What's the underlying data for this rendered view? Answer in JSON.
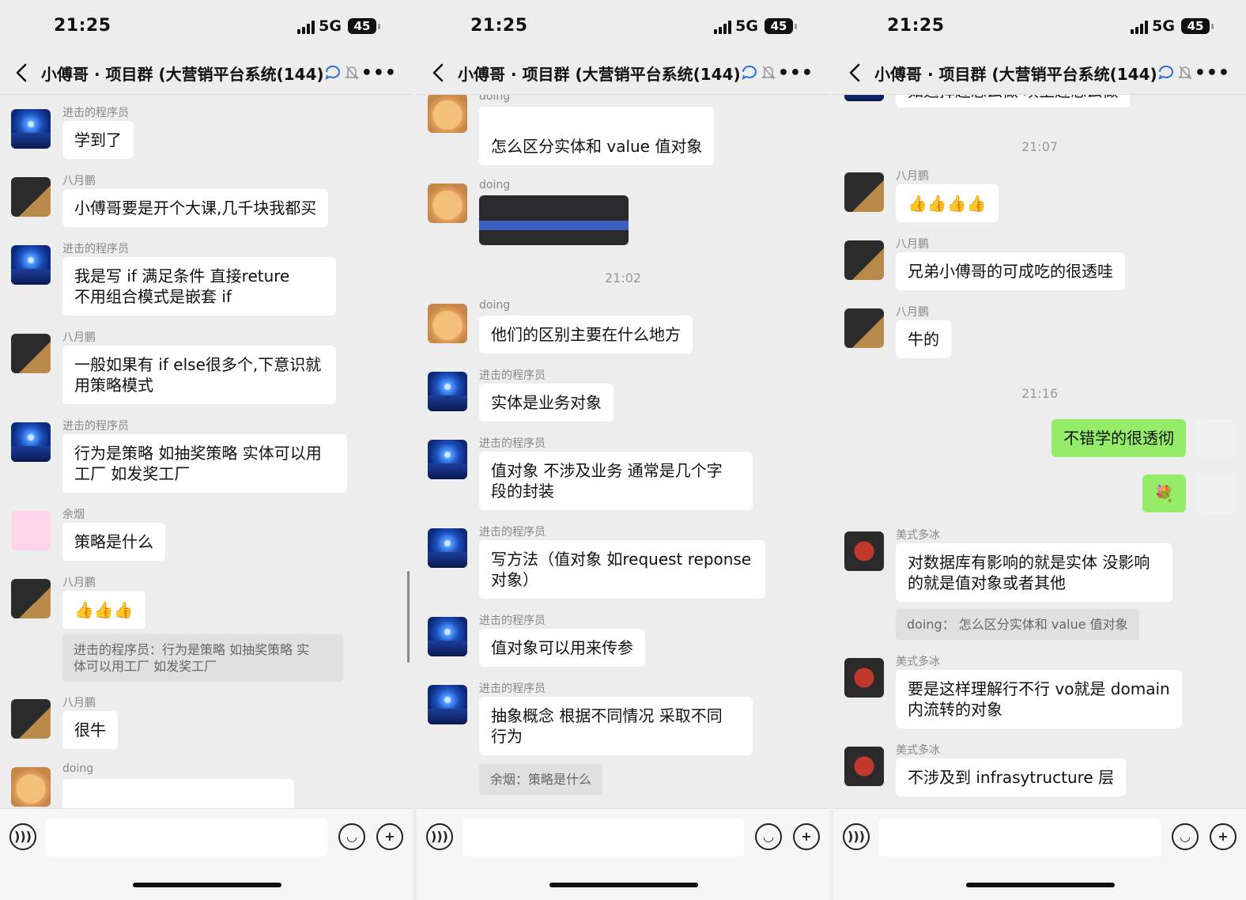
{
  "status": {
    "time": "21:25",
    "network": "5G",
    "battery": "45"
  },
  "navbar": {
    "title": "小傅哥 · 项目群 (大营销平台系统(144)"
  },
  "screens": [
    {
      "messages": [
        {
          "sender": "进击的程序员",
          "text": "学到了"
        },
        {
          "sender": "八月鹏",
          "text": "小傅哥要是开个大课,几千块我都买"
        },
        {
          "sender": "进击的程序员",
          "text": "我是写 if 满足条件 直接reture\n不用组合模式是嵌套 if"
        },
        {
          "sender": "八月鹏",
          "text": "一般如果有 if else很多个,下意识就\n用策略模式"
        },
        {
          "sender": "进击的程序员",
          "text": "行为是策略 如抽奖策略 实体可以用\n工厂 如发奖工厂"
        },
        {
          "sender": "余烟",
          "text": "策略是什么"
        },
        {
          "sender": "八月鹏",
          "text": "👍👍👍",
          "quote": "进击的程序员：行为是策略 如抽奖策略 实\n体可以用工厂 如发奖工厂"
        },
        {
          "sender": "八月鹏",
          "text": "很牛"
        },
        {
          "sender": "doing",
          "text": ""
        }
      ]
    },
    {
      "messages": [
        {
          "sender": "doing",
          "text": "怎么区分实体和 value 值对象"
        },
        {
          "sender": "doing",
          "text": ""
        },
        {
          "timestamp": "21:02"
        },
        {
          "sender": "doing",
          "text": "他们的区别主要在什么地方"
        },
        {
          "sender": "进击的程序员",
          "text": "实体是业务对象"
        },
        {
          "sender": "进击的程序员",
          "text": "值对象 不涉及业务 通常是几个字\n段的封装"
        },
        {
          "sender": "进击的程序员",
          "text": "写方法（值对象 如request reponse\n对象）"
        },
        {
          "sender": "进击的程序员",
          "text": "值对象可以用来传参"
        },
        {
          "sender": "进击的程序员",
          "text": "抽象概念 根据不同情况 采取不同\n行为",
          "quote": "余烟：策略是什么"
        }
      ]
    },
    {
      "messages": [
        {
          "text": "如选择趣念么做 填上趣念么做"
        },
        {
          "timestamp": "21:07"
        },
        {
          "sender": "八月鹏",
          "text": "👍👍👍👍"
        },
        {
          "sender": "八月鹏",
          "text": "兄弟小傅哥的可成吃的很透哇"
        },
        {
          "sender": "八月鹏",
          "text": "牛的"
        },
        {
          "timestamp": "21:16"
        },
        {
          "text": "不错学的很透彻",
          "self": true
        },
        {
          "text": "💐",
          "self": true
        },
        {
          "sender": "美式多冰",
          "text": "对数据库有影响的就是实体 没影响\n的就是值对象或者其他",
          "quote": "doing：  怎么区分实体和 value 值对象"
        },
        {
          "sender": "美式多冰",
          "text": "要是这样理解行不行 vo就是 domain\n内流转的对象"
        },
        {
          "sender": "美式多冰",
          "text": "不涉及到 infrasytructure 层"
        }
      ]
    }
  ],
  "icons": {
    "back": "chevron-left-icon",
    "chat_bubble": "chat-bubble-icon",
    "muted": "bell-slash-icon",
    "more": "more-dots-icon",
    "voice": "voice-icon",
    "emoji": "emoji-icon",
    "plus": "plus-icon"
  },
  "colors": {
    "self_bubble": "#95ec69",
    "background": "#ededed"
  }
}
